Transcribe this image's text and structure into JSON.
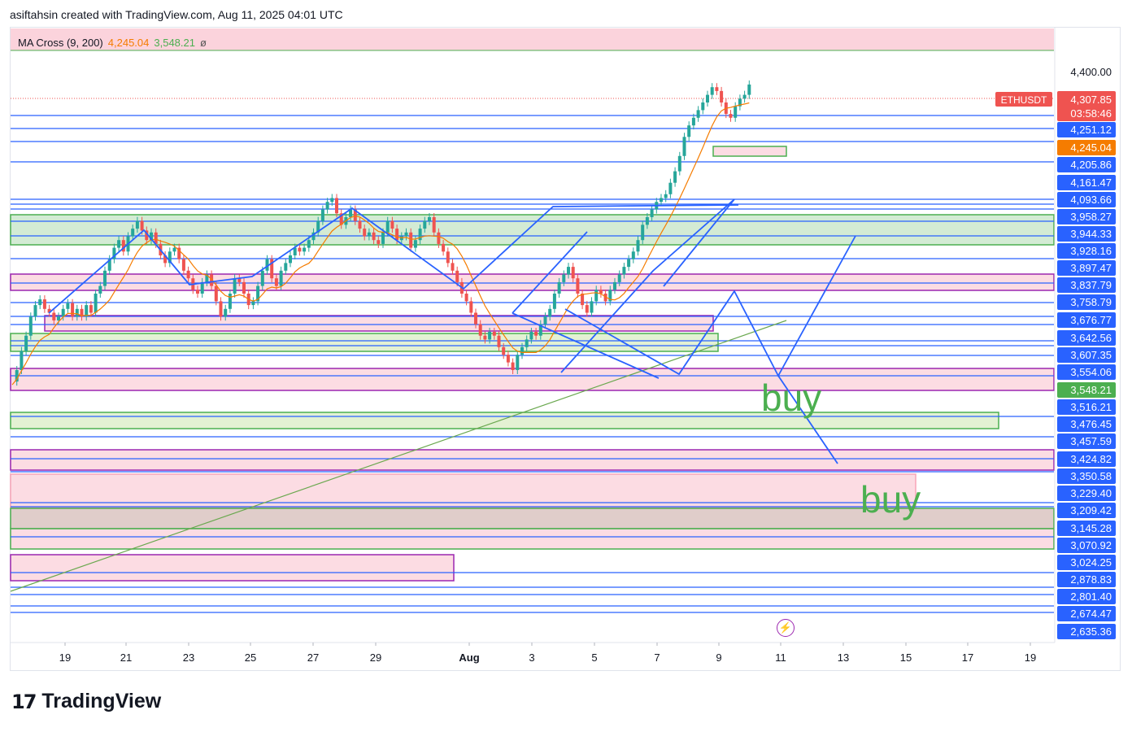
{
  "header": {
    "text": "asiftahsin created with TradingView.com, Aug 11, 2025 04:01 UTC"
  },
  "legend": {
    "indicator": "MA Cross (9, 200)",
    "ma_fast": "4,245.04",
    "ma_slow": "3,548.21",
    "extra": "ø"
  },
  "brand": {
    "mark": "17",
    "name": "TradingView"
  },
  "annotations": {
    "buy1": "buy",
    "buy2": "buy",
    "lightning_icon": "lightning-icon"
  },
  "colors": {
    "up": "#26a69a",
    "down": "#ef5350",
    "blue_line": "#2962ff",
    "green_zone": "#4caf50",
    "pink_zone": "#f8bbd0",
    "purple": "#9c27b0",
    "ma_fast": "#f57c00",
    "ma_slow": "#4caf50"
  },
  "chart_data": {
    "type": "candlestick",
    "symbol": "ETHUSDT",
    "last_price": "4,307.85",
    "countdown": "03:58:46",
    "x_ticks": [
      "19",
      "21",
      "23",
      "25",
      "27",
      "29",
      "Aug",
      "3",
      "5",
      "7",
      "9",
      "11",
      "13",
      "15",
      "17",
      "19"
    ],
    "y_ticks": [
      "4,400.00"
    ],
    "price_labels": [
      {
        "text": "4,251.12",
        "style": "blue"
      },
      {
        "text": "4,245.04",
        "style": "orange"
      },
      {
        "text": "4,205.86",
        "style": "blue"
      },
      {
        "text": "4,161.47",
        "style": "blue"
      },
      {
        "text": "4,093.66",
        "style": "blue"
      },
      {
        "text": "3,958.27",
        "style": "blue"
      },
      {
        "text": "3,944.33",
        "style": "blue"
      },
      {
        "text": "3,928.16",
        "style": "blue"
      },
      {
        "text": "3,897.47",
        "style": "blue"
      },
      {
        "text": "3,837.79",
        "style": "blue"
      },
      {
        "text": "3,758.79",
        "style": "blue"
      },
      {
        "text": "3,676.77",
        "style": "blue"
      },
      {
        "text": "3,642.56",
        "style": "blue"
      },
      {
        "text": "3,607.35",
        "style": "blue"
      },
      {
        "text": "3,554.06",
        "style": "blue"
      },
      {
        "text": "3,548.21",
        "style": "green"
      },
      {
        "text": "3,516.21",
        "style": "blue"
      },
      {
        "text": "3,476.45",
        "style": "blue"
      },
      {
        "text": "3,457.59",
        "style": "blue"
      },
      {
        "text": "3,424.82",
        "style": "blue"
      },
      {
        "text": "3,350.58",
        "style": "blue"
      },
      {
        "text": "3,229.40",
        "style": "blue"
      },
      {
        "text": "3,209.42",
        "style": "blue"
      },
      {
        "text": "3,145.28",
        "style": "blue"
      },
      {
        "text": "3,070.92",
        "style": "blue"
      },
      {
        "text": "3,024.25",
        "style": "blue"
      },
      {
        "text": "2,878.83",
        "style": "blue"
      },
      {
        "text": "2,801.40",
        "style": "blue"
      },
      {
        "text": "2,674.47",
        "style": "blue"
      },
      {
        "text": "2,635.36",
        "style": "blue"
      }
    ],
    "ma_fast_value": 4245.04,
    "ma_slow_value": 3548.21
  }
}
